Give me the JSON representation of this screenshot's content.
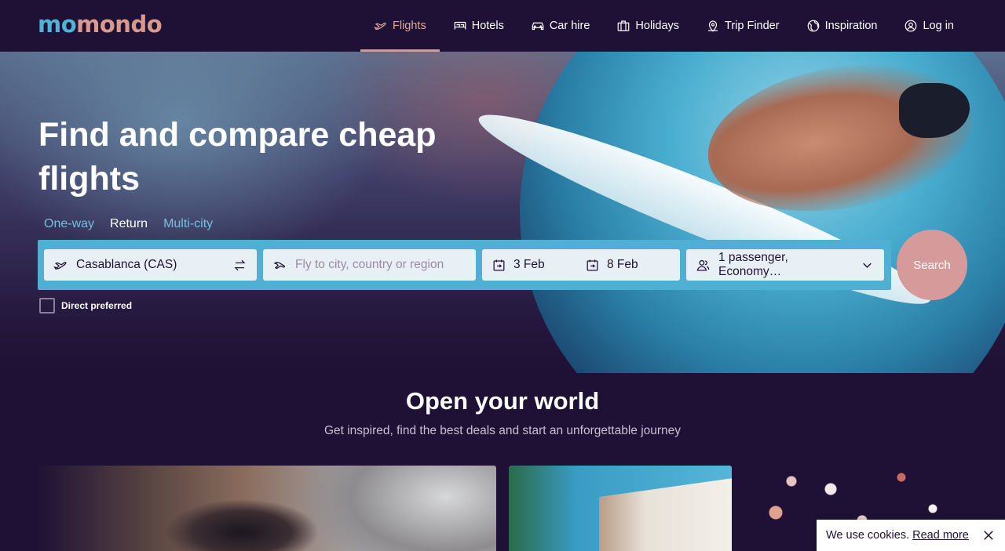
{
  "header": {
    "logo_part1": "mo",
    "logo_part2": "mondo",
    "nav": [
      {
        "label": "Flights",
        "icon": "plane-icon",
        "active": true
      },
      {
        "label": "Hotels",
        "icon": "bed-icon"
      },
      {
        "label": "Car hire",
        "icon": "car-icon"
      },
      {
        "label": "Holidays",
        "icon": "suitcase-icon"
      },
      {
        "label": "Trip Finder",
        "icon": "map-pin-icon"
      },
      {
        "label": "Inspiration",
        "icon": "globe-icon"
      },
      {
        "label": "Log in",
        "icon": "user-icon"
      }
    ]
  },
  "hero": {
    "title": "Find and compare cheap flights",
    "trip_types": [
      "One-way",
      "Return",
      "Multi-city"
    ],
    "active_trip_type": "Return"
  },
  "search": {
    "origin_value": "Casablanca (CAS)",
    "destination_placeholder": "Fly to city, country or region",
    "depart_date": "3 Feb",
    "return_date": "8 Feb",
    "passengers": "1 passenger, Economy…",
    "search_label": "Search",
    "direct_label": "Direct preferred"
  },
  "section": {
    "title": "Open your world",
    "subtitle": "Get inspired, find the best deals and start an unforgettable journey"
  },
  "cookie": {
    "text": "We use cookies.",
    "link": "Read more"
  },
  "colors": {
    "background": "#1f1135",
    "accent_blue": "#4fb0d3",
    "accent_pink": "#d79a8c"
  }
}
